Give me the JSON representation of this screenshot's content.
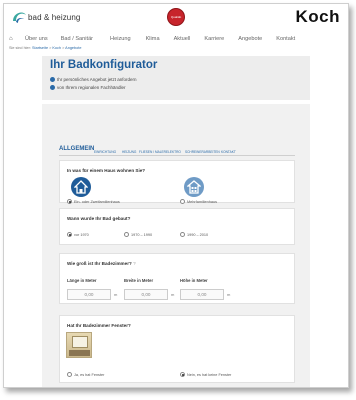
{
  "brand": {
    "logo_text": "bad & heizung",
    "company": "Koch",
    "seal_text": "Qualität"
  },
  "nav": {
    "items": [
      "Über uns",
      "Bad / Sanitär",
      "Heizung",
      "Klima",
      "Aktuell",
      "Karriere",
      "Angebote",
      "Kontakt"
    ]
  },
  "breadcrumb": {
    "prefix": "Sie sind hier:",
    "items": [
      "Startseite",
      "Koch",
      "Angebote"
    ]
  },
  "hero": {
    "title": "Ihr Badkonfigurator",
    "bullets": [
      "Ihr persönliches Angebot jetzt anfordern",
      "von Ihrem regionalen Fachhändler"
    ]
  },
  "tabs": {
    "active": "ALLGEMEIN",
    "items": [
      "EINRICHTUNG",
      "HEIZUNG",
      "FLIESEN / MALER",
      "ELEKTRO",
      "SCHREINERARBEITEN",
      "KONTAKT"
    ]
  },
  "q1": {
    "question": "In was für einem Haus wohnen Sie?",
    "options": [
      "Ein- oder Zweifamilienhaus",
      "Mehrfamilienhaus"
    ],
    "selected": 0
  },
  "q2": {
    "question": "Wann wurde Ihr Bad gebaut?",
    "options": [
      "vor 1970",
      "1970 – 1990",
      "1990 – 2010"
    ],
    "selected": 0
  },
  "q3": {
    "question": "Wie groß ist Ihr Badezimmer?",
    "hint": "?",
    "fields": [
      {
        "label": "Länge in Meter",
        "value": "0,00",
        "unit": "m"
      },
      {
        "label": "Breite in Meter",
        "value": "0,00",
        "unit": "m"
      },
      {
        "label": "Höhe in Meter",
        "value": "0,00",
        "unit": "m"
      }
    ]
  },
  "q4": {
    "question": "Hat Ihr Badezimmer Fenster?",
    "options": [
      "Ja, es hat Fenster",
      "Nein, es hat keine Fenster"
    ],
    "selected": 1
  },
  "colors": {
    "primary_blue": "#1f5c99",
    "link_blue": "#2a6aa8",
    "panel_gray": "#f1f1f1"
  }
}
